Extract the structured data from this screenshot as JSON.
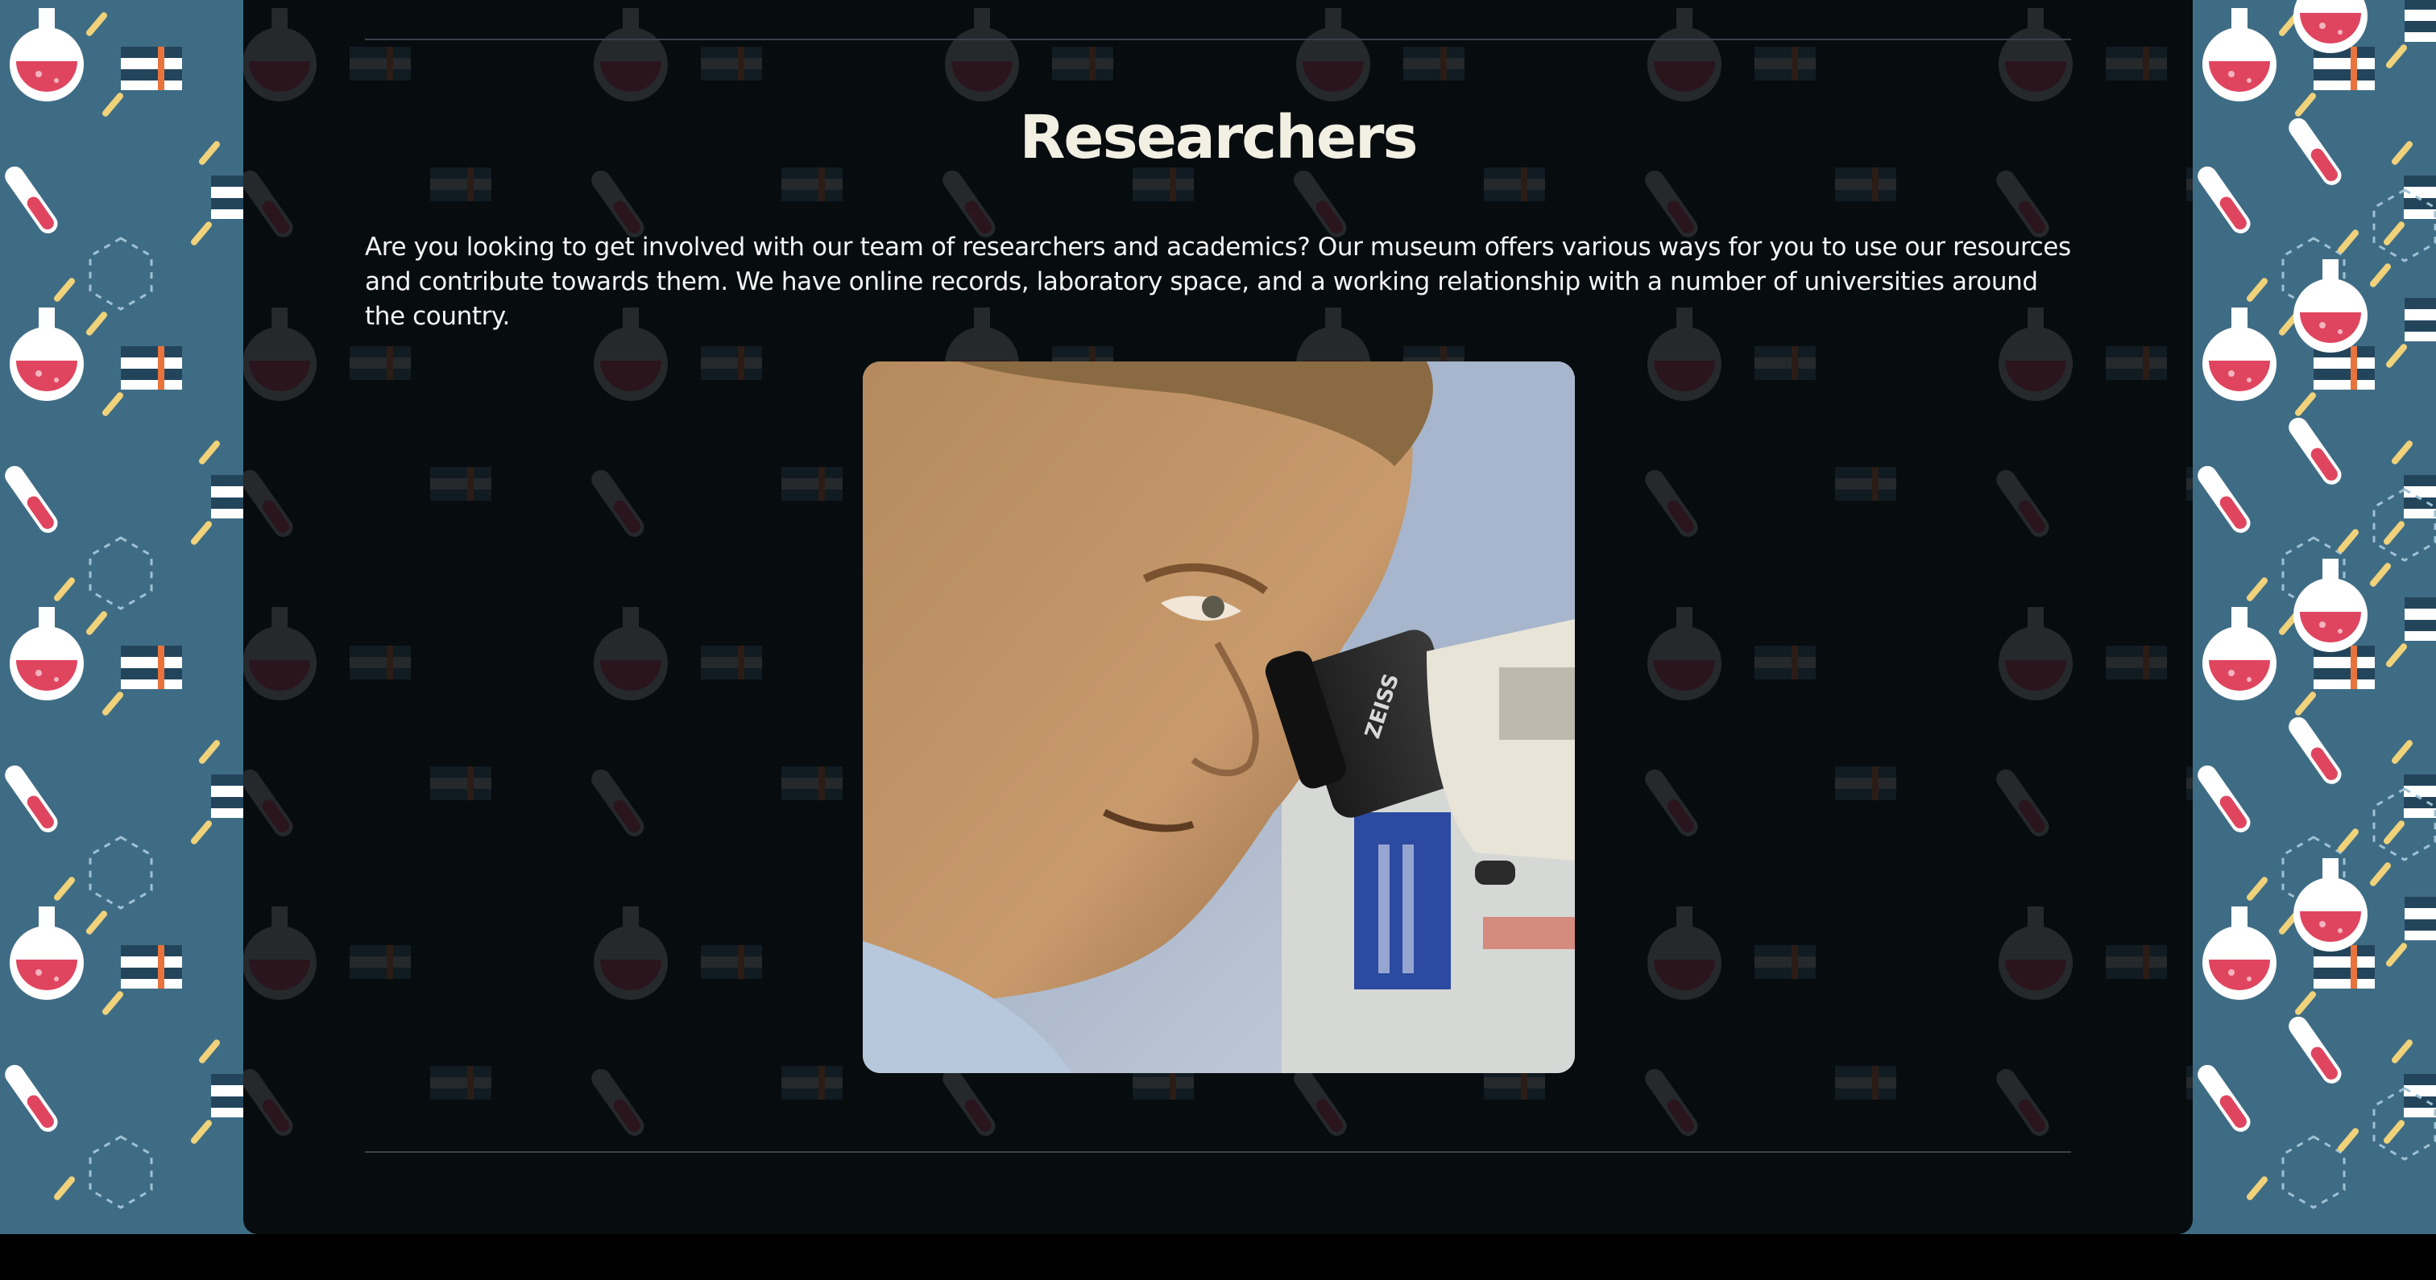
{
  "section": {
    "title": "Researchers",
    "intro": "Are you looking to get involved with our team of researchers and academics? Our museum offers various ways for you to use our resources and contribute towards them. We have online records, laboratory space, and a working relationship with a number of universities around the country."
  },
  "image": {
    "subject": "researcher-looking-into-microscope",
    "microscope_label": "ZEISS"
  },
  "colors": {
    "background_pattern": "#3f6c85",
    "panel": "#070c0f",
    "flask_liquid": "#e0455f",
    "accent_dash": "#f0d27a",
    "rule": "#39414a",
    "title_text": "#f2efe3"
  },
  "background": {
    "pattern_icons": [
      "flask-icon",
      "test-tube-icon",
      "book-stack-icon",
      "hexagon-icon"
    ]
  }
}
